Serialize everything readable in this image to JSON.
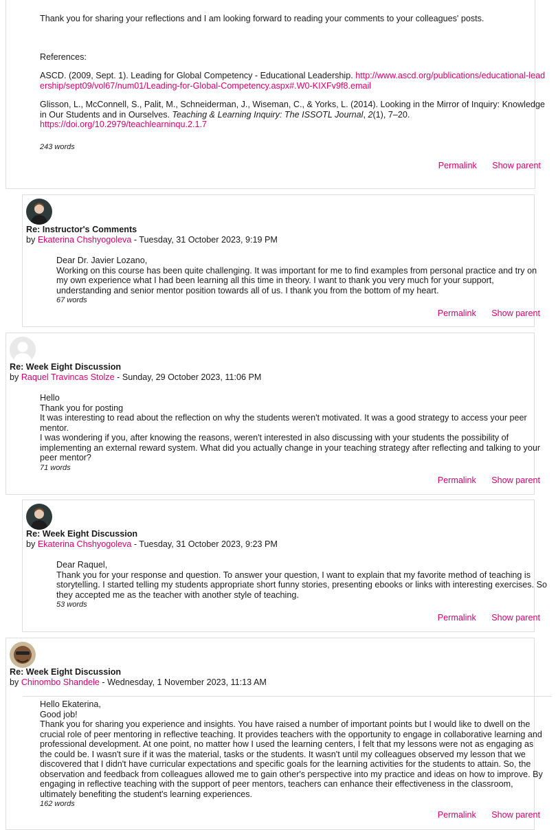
{
  "post0": {
    "closing": "Thank you for sharing your reflections and I am looking forward to reading your comments to your colleagues' posts.",
    "references_label": "References:",
    "ref1_text": "ASCD. (2009, Sept. 1).  Leading for Global Competency - Educational Leadership. ",
    "ref1_link": "http://www.ascd.org/publications/educational-leadership/sept09/vol67/num01/Leading-for-Global-Competency.aspx#.W0-KIXFv9f8.email",
    "ref2_text_a": "Glisson, L., McConnell, S., Palit, M., Schneiderman, J., Wiseman, C., & Yorks, L. (2014). Looking in the Mirror of Inquiry: Knowledge in Our Students and in Ourselves. ",
    "ref2_journal": "Teaching & Learning Inquiry: The ISSOTL Journal",
    "ref2_sep1": ", ",
    "ref2_vol": "2",
    "ref2_text_b": "(1), 7–20. ",
    "ref2_link": "https://doi.org/10.2979/teachlearninqu.2.1.7",
    "word_count": "243 words"
  },
  "post1": {
    "subject": "Re: Instructor's Comments",
    "by": "by ",
    "author": "Ekaterina Chshyogoleva",
    "date": " - Tuesday, 31 October 2023, 9:19 PM",
    "greeting": "Dear Dr. Javier Lozano,",
    "message": "Working on this course has been quite challenging. It was important for me to find examples from personal practice and try on my own experience what I had been learning all this time in theory. I want to thank you very much for your support, understanding and senior mentor position towards all of us. I thank you from the bottom of my heart.",
    "word_count": "67 words"
  },
  "post2": {
    "subject": "Re: Week Eight Discussion",
    "by": "by ",
    "author": "Raquel Travincas Stolze",
    "date": " - Sunday, 29 October 2023, 11:06 PM",
    "line1": "Hello",
    "line2": "Thank you for posting",
    "line3": "It was interesting to read about the reflection on why the students weren't motivated. It was a good strategy to access your peer mentor.",
    "line4": "I was wondering if you, after knowing the reasons, weren't interested in also discussing with your students the possibility of implementing an external reward system. What did you actually change in your teaching strategy after reflecting and talking to your peer mentor?",
    "word_count": "71 words"
  },
  "post3": {
    "subject": "Re: Week Eight Discussion",
    "by": "by ",
    "author": "Ekaterina Chshyogoleva",
    "date": " - Tuesday, 31 October 2023, 9:23 PM",
    "greeting": "Dear Raquel,",
    "message": "Thank you for your response and question. To answer your question, I want to explain that my favorite method of teaching is storytelling. I started telling my students appropriate short funny stories, presenting ebooks or links with interesting exercises. So they accepted me as the teacher with another style of teaching.",
    "word_count": "53 words"
  },
  "post4": {
    "subject": "Re: Week Eight Discussion",
    "by": "by ",
    "author": "Chinombo Shandele",
    "date": " - Wednesday, 1 November 2023, 11:13 AM",
    "line1": "Hello Ekaterina,",
    "line2": "Good job!",
    "message": "Thank you for sharing you experience and insights. You have raised a number of important points but I would like to dwell on the crucial role of peer mentoring in reflective teaching. It provides teachers with the opportunity to engage in collaborative learning and professional development. At one point, no matter how I used the learning centers, I felt that my lessons were not as engaging as the could be. I wasn't sure if it was the material, tasks or the students. It wasn't until my colleagues observed my lesson that we discovered that I didn't have curricular expectations and specific goals for the learning activities for the students to attain. So, the observation and feedback from colleagues allowed me to gain other's perspective into my practice and ideas on how to improve. By engaging in reflective teaching with the support of peer mentors, teachers can enhance their effectiveness in the classroom, ultimately benefiting the student's learning experiences.",
    "word_count": "162 words"
  },
  "commands": {
    "permalink": "Permalink",
    "show_parent": "Show parent"
  },
  "colors": {
    "link": "#d6006f",
    "border": "#dedede",
    "text": "#1a1a1a"
  }
}
